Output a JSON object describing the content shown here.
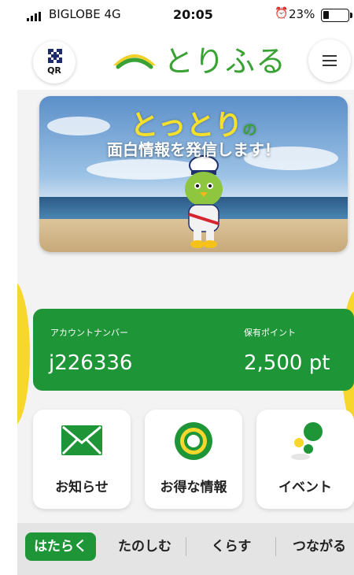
{
  "status_bar": {
    "carrier": "BIGLOBE 4G",
    "time": "20:05",
    "battery_percent": "23%",
    "battery_level": 0.23,
    "icons": [
      "signal-icon",
      "alarm-icon",
      "battery-icon"
    ]
  },
  "header": {
    "qr_label": "QR",
    "logo_text": "とりふる",
    "icons": [
      "qr-code-icon",
      "logo-mark-icon",
      "hamburger-menu-icon"
    ]
  },
  "banner": {
    "title": "とっとり",
    "title_suffix": "の",
    "subtitle": "面白情報を発信します！"
  },
  "account": {
    "account_label": "アカウントナンバー",
    "account_number": "j226336",
    "points_label": "保有ポイント",
    "points_value": "2,500 pt"
  },
  "tiles": [
    {
      "label": "お知らせ",
      "icon": "envelope-icon"
    },
    {
      "label": "お得な情報",
      "icon": "ring-target-icon"
    },
    {
      "label": "イベント",
      "icon": "dots-icon"
    }
  ],
  "tabs": [
    {
      "label": "はたらく",
      "active": true
    },
    {
      "label": "たのしむ",
      "active": false
    },
    {
      "label": "くらす",
      "active": false
    },
    {
      "label": "つながる",
      "active": false
    }
  ],
  "colors": {
    "brand_green": "#1e9638",
    "logo_green": "#3aa234",
    "accent_yellow": "#f7d72c"
  }
}
